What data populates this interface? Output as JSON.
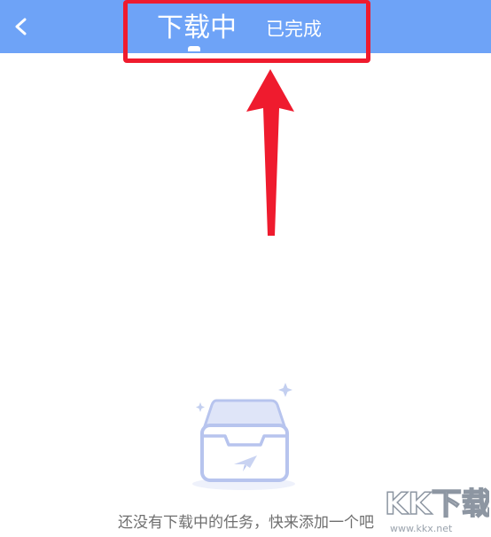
{
  "header": {
    "back_icon": "chevron-left-icon",
    "tabs": [
      {
        "label": "下载中",
        "active": true
      },
      {
        "label": "已完成",
        "active": false
      }
    ],
    "background_color": "#6ea3f7"
  },
  "annotation": {
    "highlight_color": "#ef1b2e",
    "arrow_icon": "up-arrow-annotation-icon"
  },
  "empty_state": {
    "illustration": "empty-inbox-icon",
    "message": "还没有下载中的任务，快来添加一个吧"
  },
  "watermark": {
    "logo_text": "KK下载",
    "url": "www.kkx.net"
  }
}
